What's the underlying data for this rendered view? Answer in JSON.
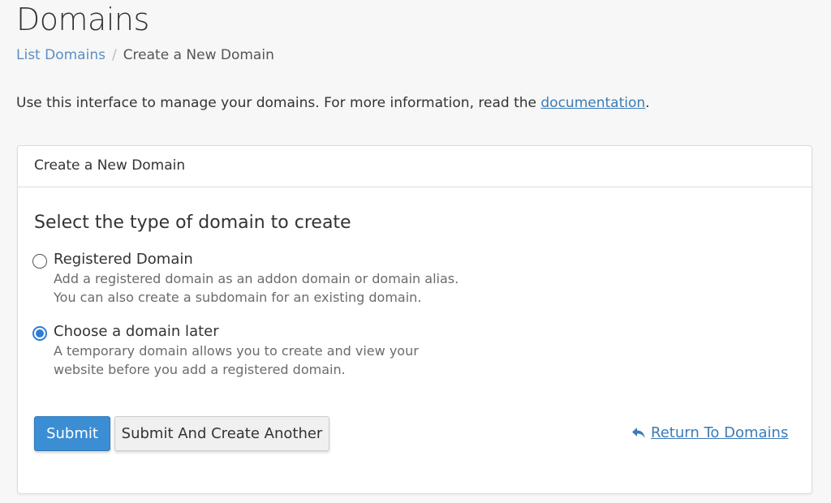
{
  "page": {
    "title": "Domains",
    "intro_text": "Use this interface to manage your domains. For more information, read the ",
    "intro_link": "documentation",
    "intro_end": "."
  },
  "breadcrumb": {
    "items": [
      {
        "label": "List Domains"
      },
      {
        "label": "Create a New Domain"
      }
    ],
    "separator": "/"
  },
  "panel": {
    "heading": "Create a New Domain",
    "section_title": "Select the type of domain to create",
    "options": [
      {
        "label": "Registered Domain",
        "desc_line1": "Add a registered domain as an addon domain or domain alias.",
        "desc_line2": "You can also create a subdomain for an existing domain.",
        "checked": false
      },
      {
        "label": "Choose a domain later",
        "desc_line1": "A temporary domain allows you to create and view your",
        "desc_line2": "website before you add a registered domain.",
        "checked": true
      }
    ],
    "submit_label": "Submit",
    "submit_another_label": "Submit And Create Another",
    "return_label": "Return To Domains",
    "return_icon": "reply-arrow-icon"
  },
  "colors": {
    "link": "#3b7bb8",
    "primary_button": "#3b8dd4",
    "radio_checked": "#2f7cd6"
  }
}
